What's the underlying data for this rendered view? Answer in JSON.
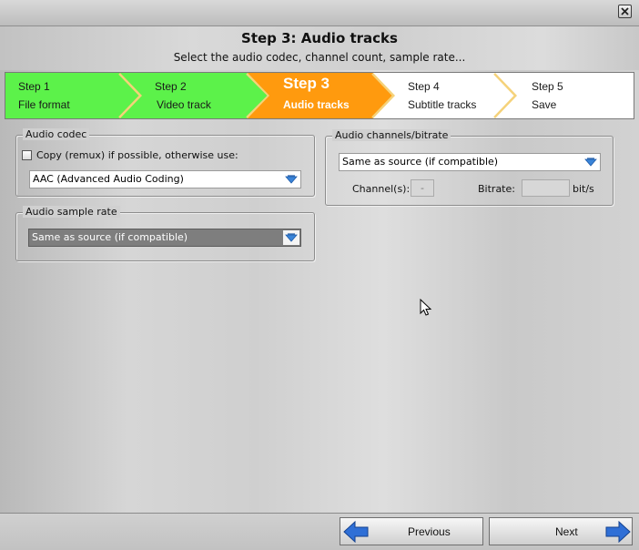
{
  "window": {
    "close_icon": "close-icon"
  },
  "header": {
    "title": "Step 3: Audio tracks",
    "subtitle": "Select the audio codec, channel count, sample rate..."
  },
  "steps": [
    {
      "number": "Step 1",
      "name": "File format",
      "state": "done",
      "color": "#5cf24a"
    },
    {
      "number": "Step 2",
      "name": "Video track",
      "state": "done",
      "color": "#5cf24a"
    },
    {
      "number": "Step 3",
      "name": "Audio tracks",
      "state": "active",
      "color": "#ff9a0e"
    },
    {
      "number": "Step 4",
      "name": "Subtitle tracks",
      "state": "todo",
      "color": "#ffffff"
    },
    {
      "number": "Step 5",
      "name": "Save",
      "state": "todo",
      "color": "#ffffff"
    }
  ],
  "audio_codec": {
    "title": "Audio codec",
    "copy_label": "Copy (remux) if possible, otherwise use:",
    "copy_checked": false,
    "codec_value": "AAC (Advanced Audio Coding)"
  },
  "audio_sample_rate": {
    "title": "Audio sample rate",
    "value": "Same as source (if compatible)"
  },
  "audio_channels": {
    "title": "Audio channels/bitrate",
    "value": "Same as source (if compatible)",
    "channels_label": "Channel(s):",
    "channels_value": "-",
    "bitrate_label": "Bitrate:",
    "bitrate_value": "",
    "bitrate_unit": "bit/s"
  },
  "footer": {
    "previous_label": "Previous",
    "next_label": "Next"
  },
  "colors": {
    "accent_arrow": "#2f6fd6"
  }
}
